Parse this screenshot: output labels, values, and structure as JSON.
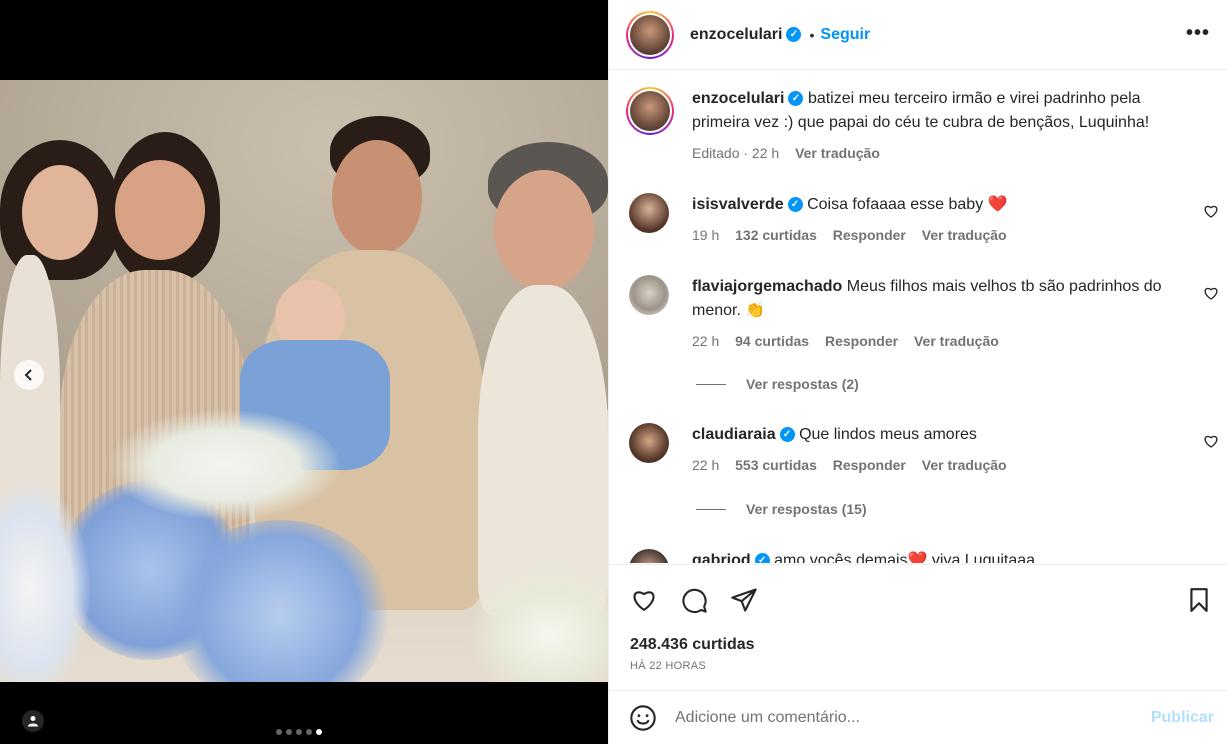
{
  "post": {
    "username": "enzocelulari",
    "follow_label": "Seguir",
    "more_label": "•••",
    "separator": "•",
    "caption": "batizei meu terceiro irmão e virei padrinho pela primeira vez :) que papai do céu te cubra de bençãos, Luquinha!",
    "caption_edited": "Editado · 22 h",
    "caption_translate": "Ver tradução",
    "likes": "248.436 curtidas",
    "time_ago": "HÁ 22 HORAS",
    "carousel_total": 5,
    "carousel_active": 5
  },
  "comments": [
    {
      "username": "isisvalverde",
      "verified": true,
      "text": "Coisa fofaaaa esse baby ❤️",
      "time": "19 h",
      "likes": "132 curtidas",
      "reply": "Responder",
      "translate": "Ver tradução"
    },
    {
      "username": "flaviajorgemachado",
      "verified": false,
      "text": "Meus filhos mais velhos tb são padrinhos do menor. 👏",
      "time": "22 h",
      "likes": "94 curtidas",
      "reply": "Responder",
      "translate": "Ver tradução",
      "replies_label": "Ver respostas (2)"
    },
    {
      "username": "claudiaraia",
      "verified": true,
      "text": "Que lindos meus amores",
      "time": "22 h",
      "likes": "553 curtidas",
      "reply": "Responder",
      "translate": "Ver tradução",
      "replies_label": "Ver respostas (15)"
    },
    {
      "username": "gabriod",
      "verified": true,
      "text": "amo vocês demais❤️ viva Luquitaaa",
      "partial": true
    }
  ],
  "composer": {
    "placeholder": "Adicione um comentário...",
    "publish_label": "Publicar"
  },
  "colors": {
    "accent": "#0095f6",
    "text": "#262626",
    "muted": "#737373",
    "publish_disabled": "#b2dffc"
  }
}
